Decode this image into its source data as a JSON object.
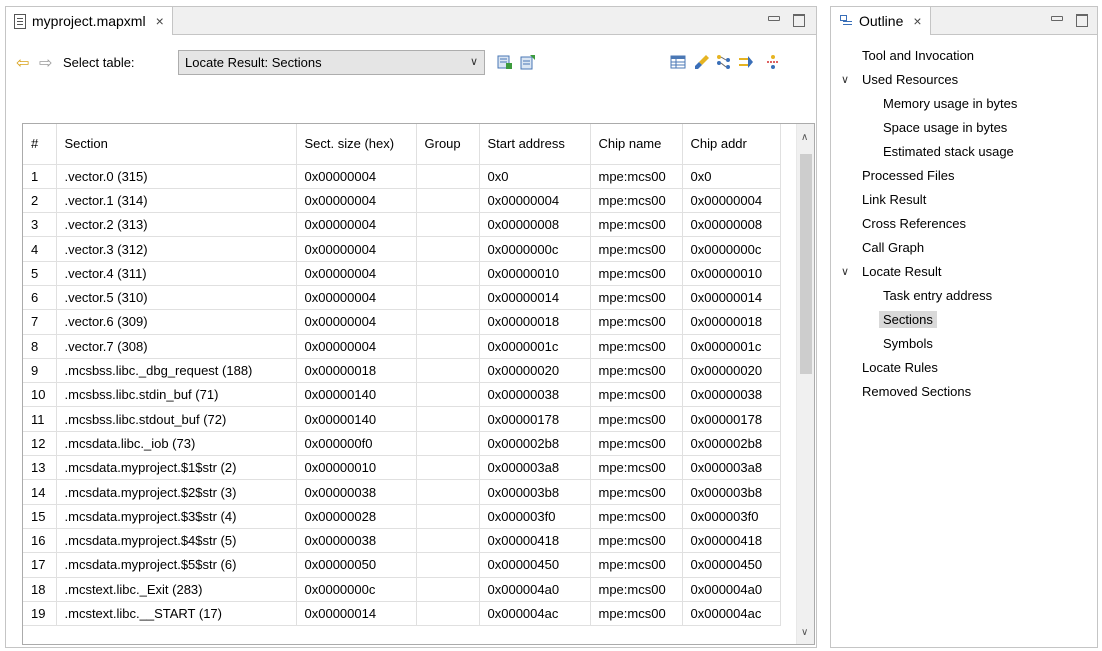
{
  "editor": {
    "tab_title": "myproject.mapxml",
    "tab_close": "×",
    "toolbar": {
      "select_label": "Select table:",
      "selected_table": "Locate Result: Sections"
    },
    "table": {
      "columns": [
        "#",
        "Section",
        "Sect. size (hex)",
        "Group",
        "Start address",
        "Chip name",
        "Chip addr"
      ],
      "rows": [
        [
          "1",
          ".vector.0 (315)",
          "0x00000004",
          "",
          "0x0",
          "mpe:mcs00",
          "0x0"
        ],
        [
          "2",
          ".vector.1 (314)",
          "0x00000004",
          "",
          "0x00000004",
          "mpe:mcs00",
          "0x00000004"
        ],
        [
          "3",
          ".vector.2 (313)",
          "0x00000004",
          "",
          "0x00000008",
          "mpe:mcs00",
          "0x00000008"
        ],
        [
          "4",
          ".vector.3 (312)",
          "0x00000004",
          "",
          "0x0000000c",
          "mpe:mcs00",
          "0x0000000c"
        ],
        [
          "5",
          ".vector.4 (311)",
          "0x00000004",
          "",
          "0x00000010",
          "mpe:mcs00",
          "0x00000010"
        ],
        [
          "6",
          ".vector.5 (310)",
          "0x00000004",
          "",
          "0x00000014",
          "mpe:mcs00",
          "0x00000014"
        ],
        [
          "7",
          ".vector.6 (309)",
          "0x00000004",
          "",
          "0x00000018",
          "mpe:mcs00",
          "0x00000018"
        ],
        [
          "8",
          ".vector.7 (308)",
          "0x00000004",
          "",
          "0x0000001c",
          "mpe:mcs00",
          "0x0000001c"
        ],
        [
          "9",
          ".mcsbss.libc._dbg_request (188)",
          "0x00000018",
          "",
          "0x00000020",
          "mpe:mcs00",
          "0x00000020"
        ],
        [
          "10",
          ".mcsbss.libc.stdin_buf (71)",
          "0x00000140",
          "",
          "0x00000038",
          "mpe:mcs00",
          "0x00000038"
        ],
        [
          "11",
          ".mcsbss.libc.stdout_buf (72)",
          "0x00000140",
          "",
          "0x00000178",
          "mpe:mcs00",
          "0x00000178"
        ],
        [
          "12",
          ".mcsdata.libc._iob (73)",
          "0x000000f0",
          "",
          "0x000002b8",
          "mpe:mcs00",
          "0x000002b8"
        ],
        [
          "13",
          ".mcsdata.myproject.$1$str (2)",
          "0x00000010",
          "",
          "0x000003a8",
          "mpe:mcs00",
          "0x000003a8"
        ],
        [
          "14",
          ".mcsdata.myproject.$2$str (3)",
          "0x00000038",
          "",
          "0x000003b8",
          "mpe:mcs00",
          "0x000003b8"
        ],
        [
          "15",
          ".mcsdata.myproject.$3$str (4)",
          "0x00000028",
          "",
          "0x000003f0",
          "mpe:mcs00",
          "0x000003f0"
        ],
        [
          "16",
          ".mcsdata.myproject.$4$str (5)",
          "0x00000038",
          "",
          "0x00000418",
          "mpe:mcs00",
          "0x00000418"
        ],
        [
          "17",
          ".mcsdata.myproject.$5$str (6)",
          "0x00000050",
          "",
          "0x00000450",
          "mpe:mcs00",
          "0x00000450"
        ],
        [
          "18",
          ".mcstext.libc._Exit (283)",
          "0x0000000c",
          "",
          "0x000004a0",
          "mpe:mcs00",
          "0x000004a0"
        ],
        [
          "19",
          ".mcstext.libc.__START (17)",
          "0x00000014",
          "",
          "0x000004ac",
          "mpe:mcs00",
          "0x000004ac"
        ]
      ]
    }
  },
  "outline": {
    "tab_title": "Outline",
    "tab_close": "×",
    "items": [
      {
        "label": "Tool and Invocation",
        "level": 0,
        "toggle": ""
      },
      {
        "label": "Used Resources",
        "level": 0,
        "toggle": "∨"
      },
      {
        "label": "Memory usage in bytes",
        "level": 1,
        "toggle": ""
      },
      {
        "label": "Space usage in bytes",
        "level": 1,
        "toggle": ""
      },
      {
        "label": "Estimated stack usage",
        "level": 1,
        "toggle": ""
      },
      {
        "label": "Processed Files",
        "level": 0,
        "toggle": ""
      },
      {
        "label": "Link Result",
        "level": 0,
        "toggle": ""
      },
      {
        "label": "Cross References",
        "level": 0,
        "toggle": ""
      },
      {
        "label": "Call Graph",
        "level": 0,
        "toggle": ""
      },
      {
        "label": "Locate Result",
        "level": 0,
        "toggle": "∨"
      },
      {
        "label": "Task entry address",
        "level": 1,
        "toggle": ""
      },
      {
        "label": "Sections",
        "level": 1,
        "toggle": "",
        "selected": true
      },
      {
        "label": "Symbols",
        "level": 1,
        "toggle": ""
      },
      {
        "label": "Locate Rules",
        "level": 0,
        "toggle": ""
      },
      {
        "label": "Removed Sections",
        "level": 0,
        "toggle": ""
      }
    ]
  },
  "colors": {
    "accent_arrow": "#d9a21b",
    "selection": "#d9d9d9",
    "icon_blue": "#3a6fb8"
  }
}
